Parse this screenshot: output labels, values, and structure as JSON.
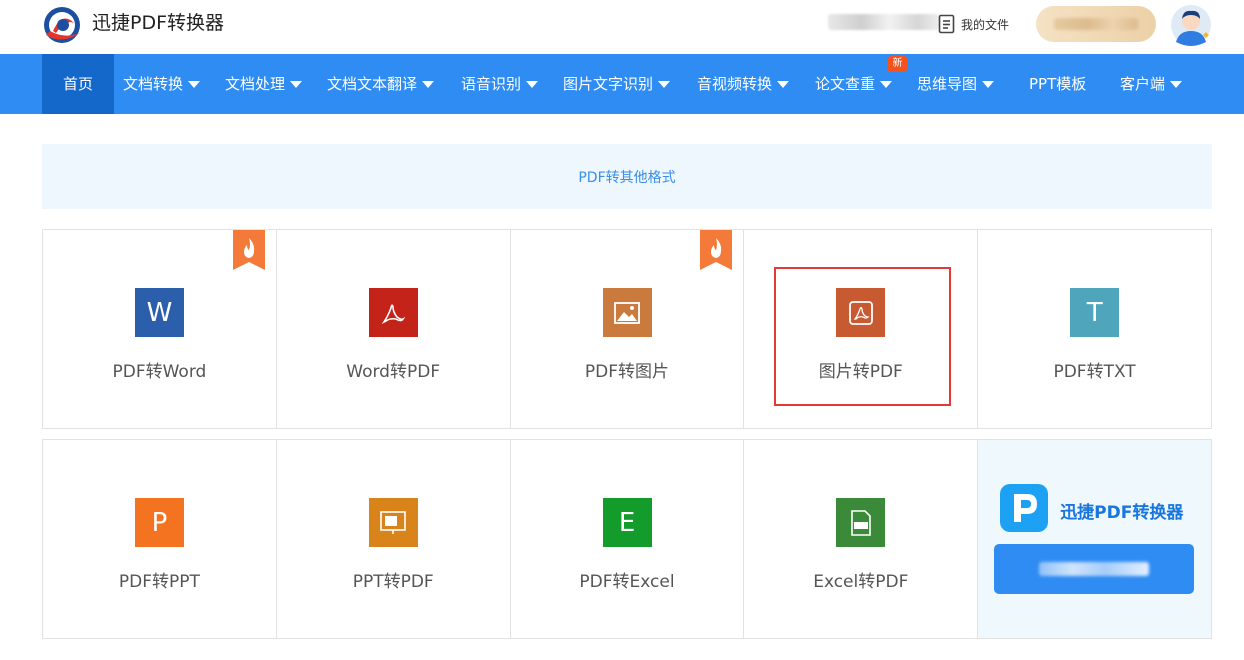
{
  "header": {
    "brand": "迅捷PDF转换器",
    "my_files": "我的文件"
  },
  "nav": {
    "items": [
      {
        "label": "首页",
        "dropdown": false
      },
      {
        "label": "文档转换",
        "dropdown": true
      },
      {
        "label": "文档处理",
        "dropdown": true
      },
      {
        "label": "文档文本翻译",
        "dropdown": true
      },
      {
        "label": "语音识别",
        "dropdown": true
      },
      {
        "label": "图片文字识别",
        "dropdown": true
      },
      {
        "label": "音视频转换",
        "dropdown": true
      },
      {
        "label": "论文查重",
        "dropdown": true
      },
      {
        "label": "思维导图",
        "dropdown": true
      },
      {
        "label": "PPT模板",
        "dropdown": false
      },
      {
        "label": "客户端",
        "dropdown": true
      }
    ],
    "new_badge": "新"
  },
  "section": {
    "title": "PDF转其他格式"
  },
  "tools_row1": [
    {
      "label": "PDF转Word",
      "icon_text": "W",
      "color": "#2b5fab",
      "hot": true
    },
    {
      "label": "Word转PDF",
      "icon_text": "",
      "color": "#c4231a",
      "hot": false
    },
    {
      "label": "PDF转图片",
      "icon_text": "",
      "color": "#c97a3c",
      "hot": true
    },
    {
      "label": "图片转PDF",
      "icon_text": "",
      "color": "#c75a31",
      "hot": false
    },
    {
      "label": "PDF转TXT",
      "icon_text": "T",
      "color": "#4fa6bc",
      "hot": false
    }
  ],
  "tools_row2": [
    {
      "label": "PDF转PPT",
      "icon_text": "P",
      "color": "#f47320"
    },
    {
      "label": "PPT转PDF",
      "icon_text": "",
      "color": "#d8841b"
    },
    {
      "label": "PDF转Excel",
      "icon_text": "E",
      "color": "#139c2b"
    },
    {
      "label": "Excel转PDF",
      "icon_text": "",
      "color": "#3a8a3a"
    }
  ],
  "promo": {
    "title": "迅捷PDF转换器"
  },
  "colors": {
    "nav_bg": "#2f8cf2",
    "nav_active": "#1468c9",
    "highlight_border": "#e53935"
  }
}
